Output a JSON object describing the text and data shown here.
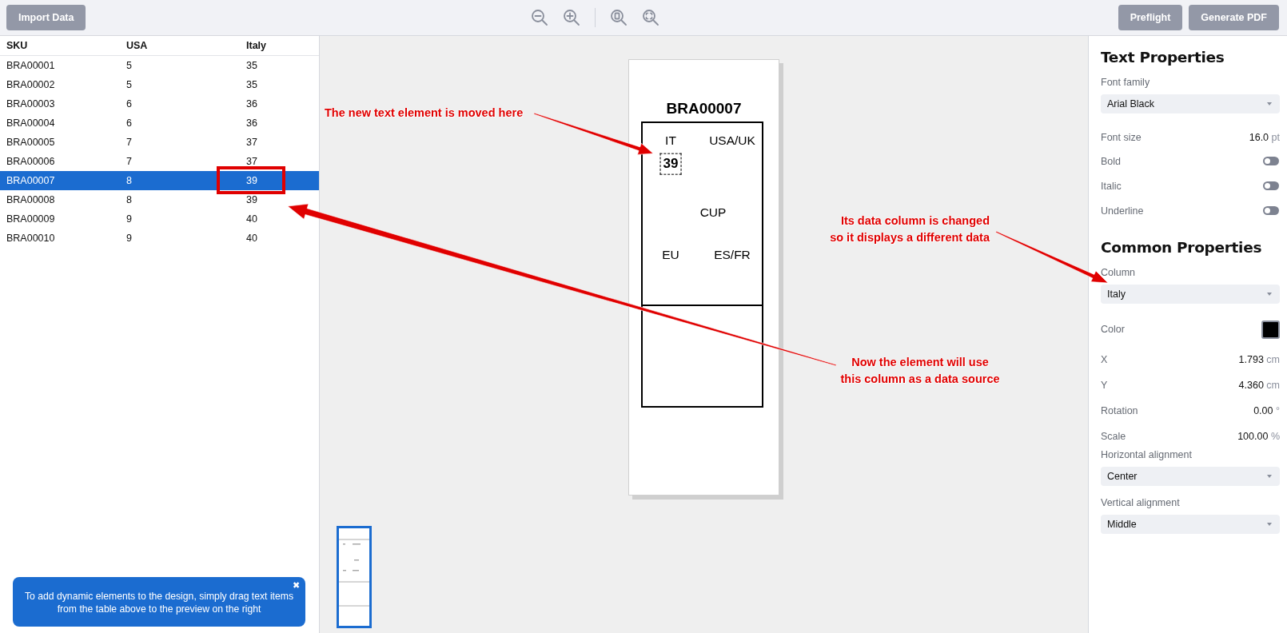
{
  "toolbar": {
    "left_buttons": [
      "Import Data"
    ],
    "right_buttons": [
      "Preflight",
      "Generate PDF"
    ]
  },
  "table": {
    "columns": [
      "SKU",
      "USA",
      "Italy"
    ],
    "rows": [
      {
        "cells": [
          "BRA00001",
          "5",
          "35"
        ],
        "selected": false
      },
      {
        "cells": [
          "BRA00002",
          "5",
          "35"
        ],
        "selected": false
      },
      {
        "cells": [
          "BRA00003",
          "6",
          "36"
        ],
        "selected": false
      },
      {
        "cells": [
          "BRA00004",
          "6",
          "36"
        ],
        "selected": false
      },
      {
        "cells": [
          "BRA00005",
          "7",
          "37"
        ],
        "selected": false
      },
      {
        "cells": [
          "BRA00006",
          "7",
          "37"
        ],
        "selected": false
      },
      {
        "cells": [
          "BRA00007",
          "8",
          "39"
        ],
        "selected": true
      },
      {
        "cells": [
          "BRA00008",
          "8",
          "39"
        ],
        "selected": false
      },
      {
        "cells": [
          "BRA00009",
          "9",
          "40"
        ],
        "selected": false
      },
      {
        "cells": [
          "BRA00010",
          "9",
          "40"
        ],
        "selected": false
      }
    ]
  },
  "tooltip": {
    "text": "To add dynamic elements to the design, simply drag text items from the table above to the preview on the right",
    "close": "✖"
  },
  "label": {
    "title": "BRA00007",
    "elements": [
      {
        "text": "IT",
        "kind": "static",
        "selected": false
      },
      {
        "text": "USA/UK",
        "kind": "static",
        "selected": false
      },
      {
        "text": "39",
        "kind": "field",
        "selected": true
      },
      {
        "text": "CUP",
        "kind": "static",
        "selected": false
      },
      {
        "text": "EU",
        "kind": "static",
        "selected": false
      },
      {
        "text": "ES/FR",
        "kind": "static",
        "selected": false
      }
    ]
  },
  "properties": {
    "sections": [
      {
        "title": "Text Properties",
        "fields": [
          {
            "kind": "select",
            "label": "Font family",
            "value": "Arial Black"
          },
          {
            "kind": "number",
            "label": "Font size",
            "value": "16.0",
            "unit": "pt"
          },
          {
            "kind": "toggle",
            "label": "Bold",
            "on": false
          },
          {
            "kind": "toggle",
            "label": "Italic",
            "on": false
          },
          {
            "kind": "toggle",
            "label": "Underline",
            "on": false
          }
        ]
      },
      {
        "title": "Common Properties",
        "fields": [
          {
            "kind": "select",
            "label": "Column",
            "value": "Italy"
          },
          {
            "kind": "color",
            "label": "Color",
            "color": "#000000"
          },
          {
            "kind": "number",
            "label": "X",
            "value": "1.793",
            "unit": "cm"
          },
          {
            "kind": "number",
            "label": "Y",
            "value": "4.360",
            "unit": "cm"
          },
          {
            "kind": "number",
            "label": "Rotation",
            "value": "0.00",
            "unit": "°"
          },
          {
            "kind": "number",
            "label": "Scale",
            "value": "100.00",
            "unit": "%"
          },
          {
            "kind": "select",
            "label": "Horizontal alignment",
            "value": "Center"
          },
          {
            "kind": "select",
            "label": "Vertical alignment",
            "value": "Middle"
          }
        ]
      }
    ]
  },
  "annotations": [
    {
      "lines": [
        "The new text element is moved here"
      ]
    },
    {
      "lines": [
        "Its data column is changed",
        "so it displays a different data"
      ]
    },
    {
      "lines": [
        "Now the element will use",
        "this column as a data source"
      ]
    }
  ]
}
